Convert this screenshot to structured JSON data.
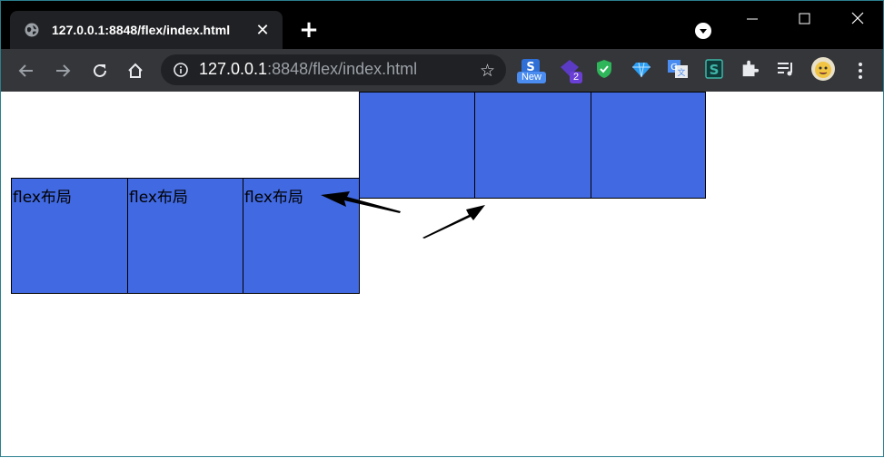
{
  "tab": {
    "title": "127.0.0.1:8848/flex/index.html",
    "close_glyph": "✕",
    "icon": "globe-icon"
  },
  "new_tab_glyph": "+",
  "address_bar": {
    "host": "127.0.0.1",
    "path": ":8848/flex/index.html"
  },
  "extensions": {
    "new_badge": "New",
    "count_badge": "2"
  },
  "page": {
    "top_row_boxes": [
      {
        "label": ""
      },
      {
        "label": ""
      },
      {
        "label": ""
      }
    ],
    "bottom_row_boxes": [
      {
        "label": "flex布局"
      },
      {
        "label": "flex布局"
      },
      {
        "label": "flex布局"
      }
    ]
  },
  "colors": {
    "box_fill": "#4169e1",
    "tab_strip": "#000000",
    "toolbar": "#35363a"
  }
}
